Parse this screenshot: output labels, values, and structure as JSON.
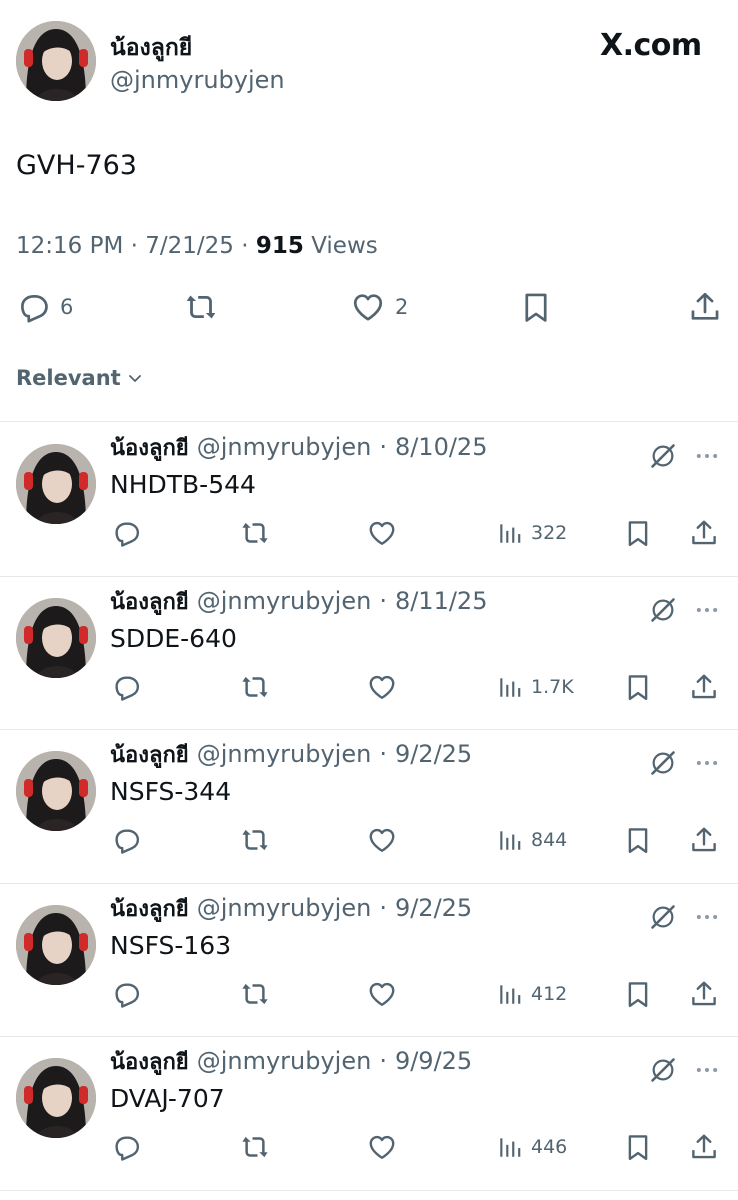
{
  "main_post": {
    "display_name": "น้องลูกยี",
    "handle": "@jnmyrubyjen",
    "brand": "X.com",
    "text": "GVH-763",
    "time": "12:16 PM",
    "date": "7/21/25",
    "views_count": "915",
    "views_label": "Views",
    "replies": "6",
    "likes": "2"
  },
  "sort": {
    "label": "Relevant"
  },
  "replies": [
    {
      "display_name": "น้องลูกยี",
      "handle": "@jnmyrubyjen",
      "date": "8/10/25",
      "text": "NHDTB-544",
      "views": "322"
    },
    {
      "display_name": "น้องลูกยี",
      "handle": "@jnmyrubyjen",
      "date": "8/11/25",
      "text": "SDDE-640",
      "views": "1.7K"
    },
    {
      "display_name": "น้องลูกยี",
      "handle": "@jnmyrubyjen",
      "date": "9/2/25",
      "text": "NSFS-344",
      "views": "844"
    },
    {
      "display_name": "น้องลูกยี",
      "handle": "@jnmyrubyjen",
      "date": "9/2/25",
      "text": "NSFS-163",
      "views": "412"
    },
    {
      "display_name": "น้องลูกยี",
      "handle": "@jnmyrubyjen",
      "date": "9/9/25",
      "text": "DVAJ-707",
      "views": "446"
    }
  ],
  "icons": {
    "reply": "reply-icon",
    "repost": "repost-icon",
    "like": "like-icon",
    "bookmark": "bookmark-icon",
    "share": "share-icon",
    "views": "views-icon",
    "grok": "grok-icon",
    "more": "more-icon",
    "chevron": "chevron-down-icon"
  },
  "colors": {
    "text": "#0f1419",
    "secondary": "#536471",
    "divider": "#e6e9ec"
  }
}
